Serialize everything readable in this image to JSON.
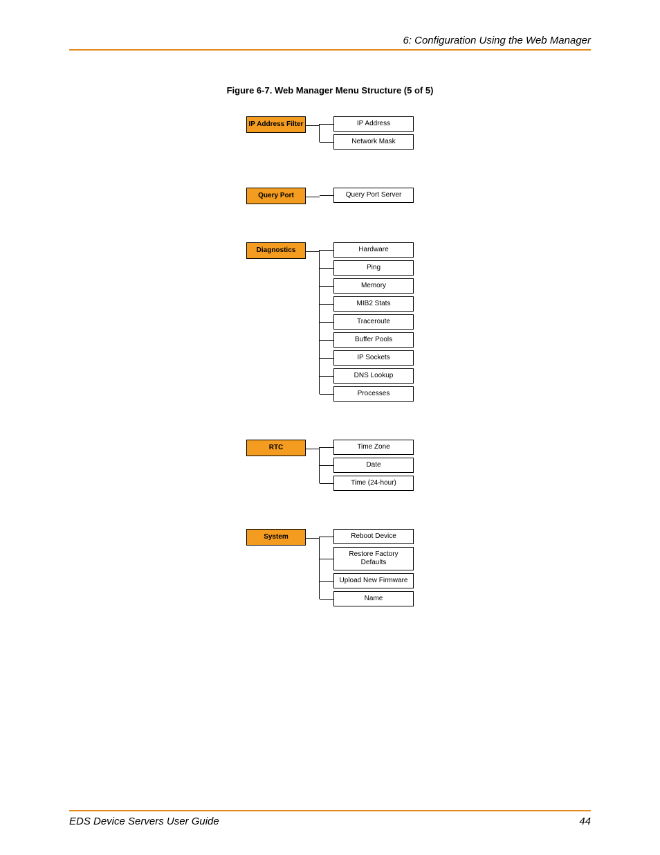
{
  "header": {
    "chapter_title": "6: Configuration Using the Web Manager"
  },
  "figure": {
    "caption": "Figure 6-7. Web Manager Menu Structure (5 of 5)"
  },
  "menus": [
    {
      "parent": "IP Address Filter",
      "children": [
        "IP Address",
        "Network Mask"
      ]
    },
    {
      "parent": "Query Port",
      "children": [
        "Query Port Server"
      ]
    },
    {
      "parent": "Diagnostics",
      "children": [
        "Hardware",
        "Ping",
        "Memory",
        "MIB2 Stats",
        "Traceroute",
        "Buffer Pools",
        "IP Sockets",
        "DNS Lookup",
        "Processes"
      ]
    },
    {
      "parent": "RTC",
      "children": [
        "Time Zone",
        "Date",
        "Time (24-hour)"
      ]
    },
    {
      "parent": "System",
      "children": [
        "Reboot Device",
        "Restore Factory Defaults",
        "Upload New Firmware",
        "Name"
      ]
    }
  ],
  "footer": {
    "guide_title": "EDS Device Servers User Guide",
    "page_number": "44"
  }
}
